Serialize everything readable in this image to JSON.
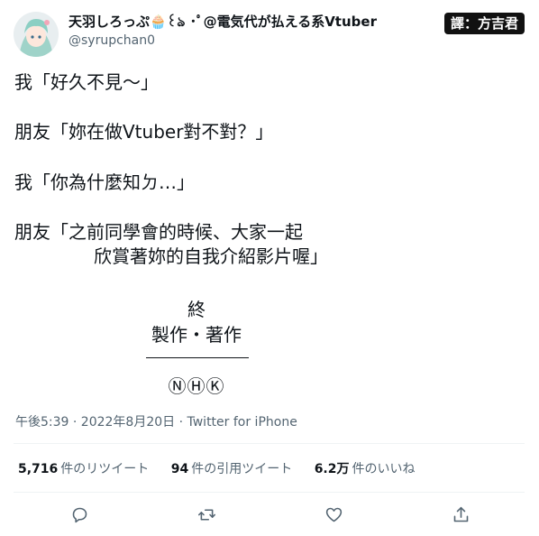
{
  "author": {
    "display_name": "天羽しろっぷ🧁꒰ঌ ･ﾟ@電気代が払える系Vtuber",
    "handle": "@syrupchan0"
  },
  "translator_badge": "譯：方吉君",
  "tweet": {
    "lines": [
      "我「好久不見～」",
      "朋友「妳在做Vtuber對不對？」",
      "我「你為什麼知ㄉ…」",
      "朋友「之前同學會的時候、大家一起",
      "欣賞著妳的自我介紹影片喔」"
    ],
    "credits": {
      "end": "終",
      "production": "製作・著作",
      "broadcaster": "ⓃⒽⓀ"
    }
  },
  "meta": "午後5:39 · 2022年8月20日 · Twitter for iPhone",
  "stats": [
    {
      "count": "5,716",
      "label": "件のリツイート"
    },
    {
      "count": "94",
      "label": "件の引用ツイート"
    },
    {
      "count": "6.2万",
      "label": "件のいいね"
    }
  ],
  "actions": [
    "reply-icon",
    "retweet-icon",
    "like-icon",
    "share-icon"
  ],
  "colors": {
    "text": "#0f1419",
    "secondary": "#536471",
    "divider": "#eff3f4"
  }
}
